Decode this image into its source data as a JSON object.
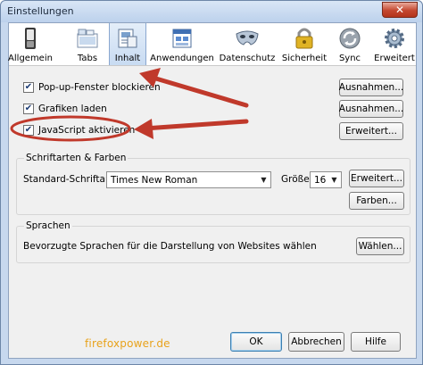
{
  "window": {
    "title": "Einstellungen",
    "close_glyph": "✕"
  },
  "toolbar": {
    "items": [
      {
        "label": "Allgemein",
        "icon": "general-switch-icon"
      },
      {
        "label": "Tabs",
        "icon": "tabs-icon"
      },
      {
        "label": "Inhalt",
        "icon": "content-document-icon",
        "selected": true
      },
      {
        "label": "Anwendungen",
        "icon": "applications-icon"
      },
      {
        "label": "Datenschutz",
        "icon": "privacy-mask-icon"
      },
      {
        "label": "Sicherheit",
        "icon": "security-lock-icon"
      },
      {
        "label": "Sync",
        "icon": "sync-icon"
      },
      {
        "label": "Erweitert",
        "icon": "advanced-gear-icon"
      }
    ]
  },
  "content_options": {
    "popup": {
      "label": "Pop-up-Fenster blockieren",
      "checked": true,
      "button": "Ausnahmen..."
    },
    "images": {
      "label": "Grafiken laden",
      "checked": true,
      "button": "Ausnahmen..."
    },
    "javascript": {
      "label": "JavaScript aktivieren",
      "checked": true,
      "button": "Erweitert..."
    }
  },
  "fonts": {
    "group_title": "Schriftarten & Farben",
    "default_font_label": "Standard-Schriftart:",
    "default_font_value": "Times New Roman",
    "size_label": "Größe:",
    "size_value": "16",
    "advanced_button": "Erweitert...",
    "colors_button": "Farben..."
  },
  "languages": {
    "group_title": "Sprachen",
    "description": "Bevorzugte Sprachen für die Darstellung von Websites wählen",
    "choose_button": "Wählen..."
  },
  "footer": {
    "ok": "OK",
    "cancel": "Abbrechen",
    "help": "Hilfe"
  },
  "watermark": "firefoxpower.de",
  "annotation_color": "#c0392b",
  "check_glyph": "✔"
}
